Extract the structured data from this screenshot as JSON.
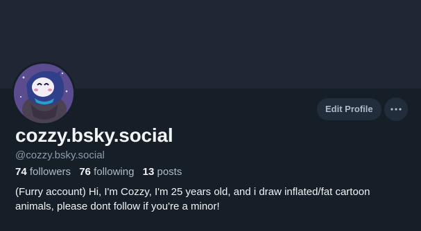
{
  "profile": {
    "display_name": "cozzy.bsky.social",
    "handle": "@cozzy.bsky.social",
    "bio": "(Furry account) Hi, I'm Cozzy, I'm 25 years old, and i draw inflated/fat cartoon animals, please dont follow if you're a minor!"
  },
  "stats": {
    "followers_count": "74",
    "followers_label": "followers",
    "following_count": "76",
    "following_label": "following",
    "posts_count": "13",
    "posts_label": "posts"
  },
  "actions": {
    "edit_profile_label": "Edit Profile",
    "more_icon": "ellipsis-icon"
  },
  "colors": {
    "background": "#161e27",
    "banner": "#1e2733",
    "button_bg": "#222d3b",
    "text_primary": "#f1f3f5",
    "text_secondary": "#8c9bab"
  }
}
